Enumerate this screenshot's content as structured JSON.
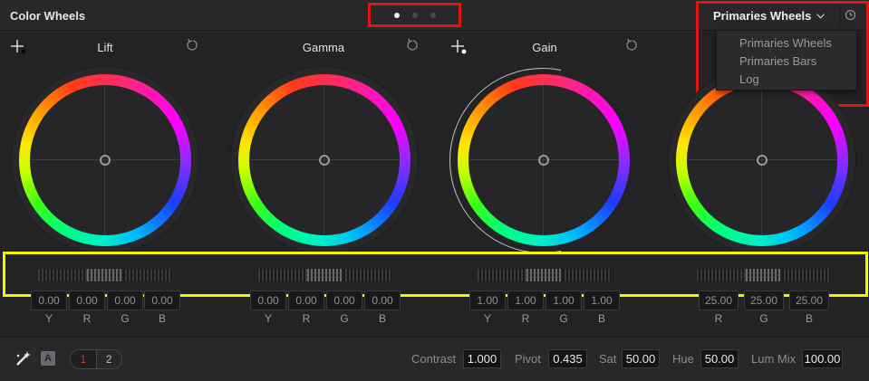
{
  "header": {
    "title": "Color Wheels",
    "mode_selected": "Primaries Wheels",
    "page_dots": [
      true,
      false,
      false
    ],
    "dropdown_options": [
      "Primaries Wheels",
      "Primaries Bars",
      "Log"
    ]
  },
  "wheels": [
    {
      "label": "Lift",
      "values": [
        "0.00",
        "0.00",
        "0.00",
        "0.00"
      ],
      "channels": [
        "Y",
        "R",
        "G",
        "B"
      ]
    },
    {
      "label": "Gamma",
      "values": [
        "0.00",
        "0.00",
        "0.00",
        "0.00"
      ],
      "channels": [
        "Y",
        "R",
        "G",
        "B"
      ]
    },
    {
      "label": "Gain",
      "values": [
        "1.00",
        "1.00",
        "1.00",
        "1.00"
      ],
      "channels": [
        "Y",
        "R",
        "G",
        "B"
      ]
    },
    {
      "label": "",
      "values": [
        "25.00",
        "25.00",
        "25.00"
      ],
      "channels": [
        "R",
        "G",
        "B"
      ]
    }
  ],
  "footer": {
    "auto_label": "A",
    "page_1": "1",
    "page_2": "2",
    "contrast_label": "Contrast",
    "contrast_value": "1.000",
    "pivot_label": "Pivot",
    "pivot_value": "0.435",
    "sat_label": "Sat",
    "sat_value": "50.00",
    "hue_label": "Hue",
    "hue_value": "50.00",
    "lummix_label": "Lum Mix",
    "lummix_value": "100.00"
  },
  "icons": {
    "picker": "crosshair-picker-icon",
    "reset": "reset-icon",
    "reset_all": "reset-all-icon",
    "auto_balance": "auto-balance-icon"
  },
  "colors": {
    "highlight_red": "#e01515",
    "highlight_yellow": "#f5f500"
  }
}
